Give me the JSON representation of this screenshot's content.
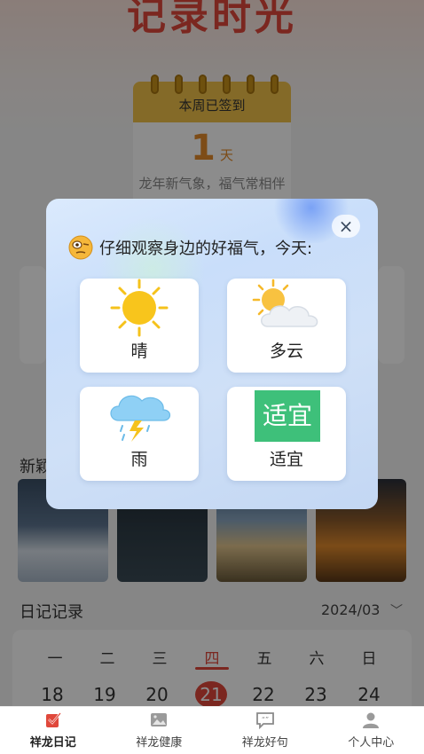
{
  "banner": {
    "title": "记录时光"
  },
  "checkin_card": {
    "header": "本周已签到",
    "days": "1",
    "unit": "天",
    "motto": "龙年新气象，福气常相伴"
  },
  "sections": {
    "new_label": "新颖",
    "diary_label": "日记记录",
    "month": "2024/03"
  },
  "calendar": {
    "weekdays": [
      "一",
      "二",
      "三",
      "四",
      "五",
      "六",
      "日"
    ],
    "dates": [
      "18",
      "19",
      "20",
      "21",
      "22",
      "23",
      "24"
    ],
    "today_index": 3,
    "accent": "#e0483b"
  },
  "modal": {
    "prompt": "仔细观察身边的好福气，今天:",
    "prompt_icon": "squinting-face-icon",
    "close_icon": "close-icon",
    "options": [
      {
        "label": "晴",
        "icon": "sun-icon"
      },
      {
        "label": "多云",
        "icon": "cloud-sun-icon"
      },
      {
        "label": "雨",
        "icon": "thunder-rain-icon"
      },
      {
        "label": "适宜",
        "icon_text": "适宜"
      }
    ]
  },
  "tabbar": {
    "items": [
      {
        "label": "祥龙日记",
        "icon": "diary-icon",
        "active": true
      },
      {
        "label": "祥龙健康",
        "icon": "image-icon",
        "active": false
      },
      {
        "label": "祥龙好句",
        "icon": "quote-icon",
        "active": false
      },
      {
        "label": "个人中心",
        "icon": "user-icon",
        "active": false
      }
    ]
  }
}
